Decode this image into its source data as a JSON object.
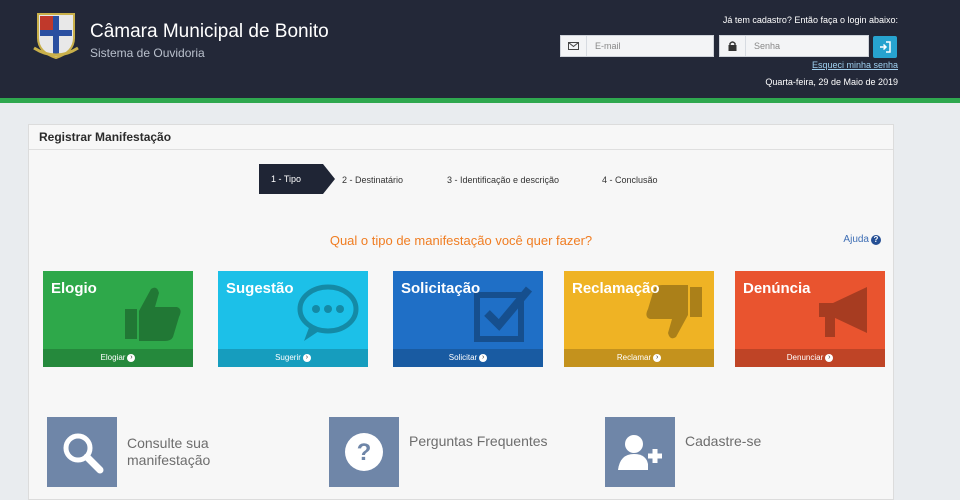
{
  "header": {
    "title": "Câmara Municipal de Bonito",
    "subtitle": "Sistema de Ouvidoria",
    "login_prompt": "Já tem cadastro? Então faça o login abaixo:",
    "email_placeholder": "E-mail",
    "password_placeholder": "Senha",
    "forgot_password": "Esqueci minha senha",
    "date": "Quarta-feira, 29 de Maio de 2019",
    "colors": {
      "bg": "#232838",
      "accent": "#2fa84f",
      "login_button": "#27a3cf"
    }
  },
  "panel": {
    "title": "Registrar Manifestação",
    "steps": [
      {
        "label": "1 - Tipo",
        "active": true
      },
      {
        "label": "2 - Destinatário",
        "active": false
      },
      {
        "label": "3 - Identificação e descrição",
        "active": false
      },
      {
        "label": "4 - Conclusão",
        "active": false
      }
    ],
    "question": "Qual o tipo de manifestação você quer fazer?",
    "help": "Ajuda",
    "types": [
      {
        "title": "Elogio",
        "action": "Elogiar",
        "color": "#2ea84a",
        "icon": "thumbs-up-icon"
      },
      {
        "title": "Sugestão",
        "action": "Sugerir",
        "color": "#1cc0e8",
        "icon": "speech-bubble-icon"
      },
      {
        "title": "Solicitação",
        "action": "Solicitar",
        "color": "#1f6fc6",
        "icon": "checkbox-icon"
      },
      {
        "title": "Reclamação",
        "action": "Reclamar",
        "color": "#efb324",
        "icon": "thumbs-down-icon"
      },
      {
        "title": "Denúncia",
        "action": "Denunciar",
        "color": "#e9542f",
        "icon": "megaphone-icon"
      }
    ],
    "quick_links": [
      {
        "label": "Consulte sua manifestação",
        "icon": "search-icon"
      },
      {
        "label": "Perguntas Frequentes",
        "icon": "question-icon"
      },
      {
        "label": "Cadastre-se",
        "icon": "add-user-icon"
      }
    ]
  }
}
